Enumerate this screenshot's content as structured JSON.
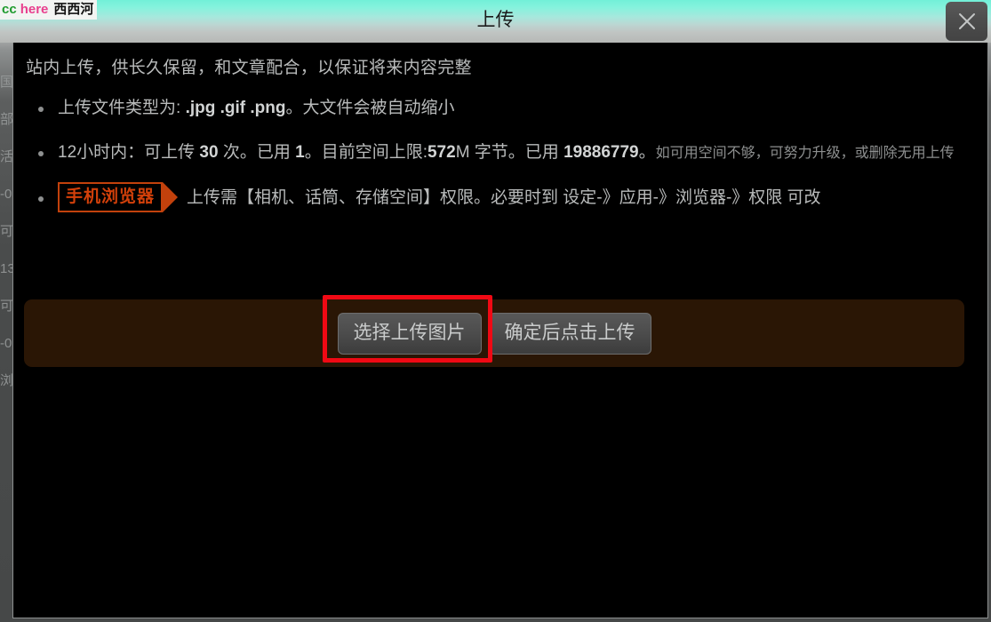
{
  "site_logo": {
    "part1": "cc",
    "part2": "here",
    "part3": "西西河"
  },
  "titlebar": {
    "title": "上传",
    "close_label": "×"
  },
  "dialog": {
    "lead": "站内上传，供长久保留，和文章配合，以保证将来内容完整",
    "notes": [
      {
        "segments": [
          {
            "text": "上传文件类型为: ",
            "style": "normal"
          },
          {
            "text": ".jpg .gif .png",
            "style": "bold"
          },
          {
            "text": "。大文件会被自动缩小",
            "style": "normal"
          }
        ]
      },
      {
        "segments": [
          {
            "text": "12小时内：可上传 ",
            "style": "normal"
          },
          {
            "text": "30",
            "style": "bold"
          },
          {
            "text": " 次。已用 ",
            "style": "normal"
          },
          {
            "text": "1",
            "style": "bold"
          },
          {
            "text": "。目前空间上限:",
            "style": "normal"
          },
          {
            "text": "572",
            "style": "bold"
          },
          {
            "text": "M 字节。已用 ",
            "style": "normal"
          },
          {
            "text": "19886779",
            "style": "bold"
          },
          {
            "text": "。",
            "style": "normal"
          },
          {
            "text": "如可用空间不够，可努力升级，或删除无用上传",
            "style": "dim"
          }
        ]
      },
      {
        "badge": "手机浏览器",
        "segments": [
          {
            "text": "上传需【相机、话筒、存储空间】权限。必要时到 设定-》应用-》浏览器-》权限 可改",
            "style": "normal"
          }
        ]
      }
    ]
  },
  "actions": {
    "choose_label": "选择上传图片",
    "upload_label": "确定后点击上传"
  },
  "background_page": {
    "lines": [
      "-",
      "国",
      "部",
      "活",
      "-0",
      "可",
      "13",
      "可",
      "-0",
      "浏"
    ]
  },
  "colors": {
    "accent_orange": "#c2410c",
    "highlight_red": "#f00914",
    "panel_brown": "#2a1605",
    "title_cyan": "#72f0d8"
  }
}
